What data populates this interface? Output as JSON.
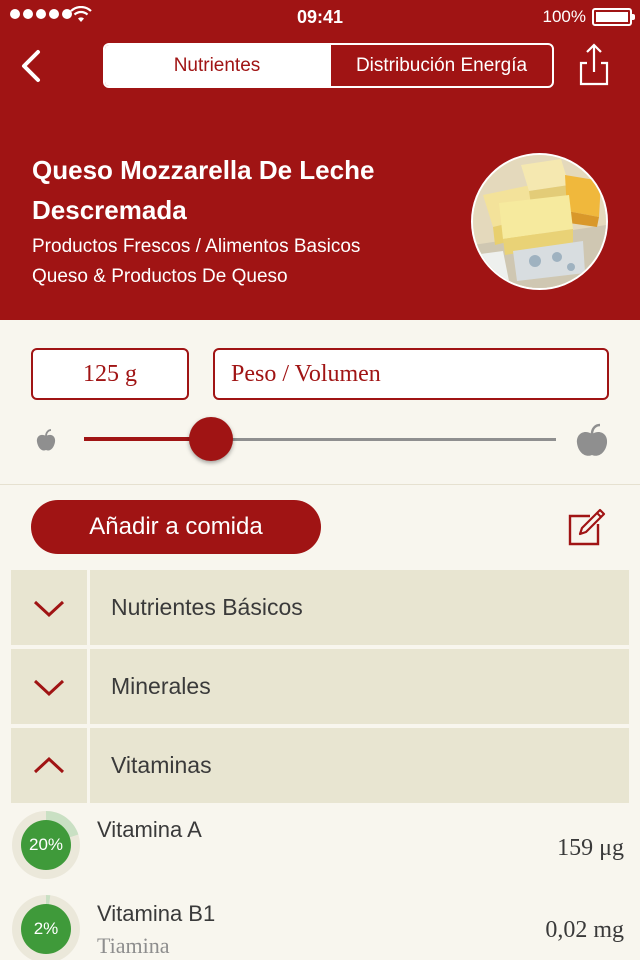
{
  "status_bar": {
    "time": "09:41",
    "battery": "100%"
  },
  "nav": {
    "back_icon": "chevron-left-icon",
    "tabs": [
      {
        "label": "Nutrientes",
        "active": true
      },
      {
        "label": "Distribución Energía",
        "active": false
      }
    ],
    "share_icon": "share-icon"
  },
  "food": {
    "title": "Queso Mozzarella De Leche Descremada",
    "category_line1": "Productos Frescos / Alimentos Basicos",
    "category_line2": "Queso & Productos De Queso",
    "image": "cheese-photo"
  },
  "portion": {
    "amount": "125 g",
    "unit": "Peso / Volumen",
    "slider_fraction": 0.27
  },
  "actions": {
    "add_label": "Añadir a comida",
    "edit_icon": "edit-icon"
  },
  "sections": [
    {
      "label": "Nutrientes Básicos",
      "expanded": false
    },
    {
      "label": "Minerales",
      "expanded": false
    },
    {
      "label": "Vitaminas",
      "expanded": true
    }
  ],
  "nutrients": [
    {
      "name": "Vitamina A",
      "subname": "",
      "percent": 20,
      "percent_label": "20%",
      "value": "159 μg"
    },
    {
      "name": "Vitamina B1",
      "subname": "Tiamina",
      "percent": 2,
      "percent_label": "2%",
      "value": "0,02 mg"
    }
  ],
  "colors": {
    "brand": "#a01414",
    "section_bg": "#e8e5d1",
    "page_bg": "#f8f6ee",
    "progress": "#3f9a3a"
  }
}
